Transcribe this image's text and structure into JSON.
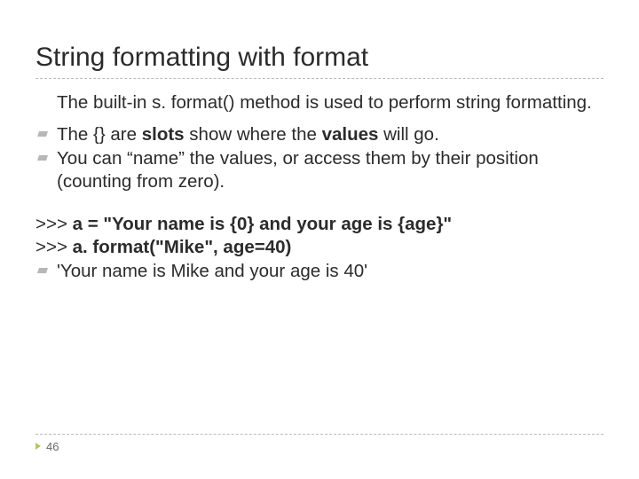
{
  "title": "String formatting with format",
  "intro": "The built-in s. format() method is used to perform string formatting.",
  "bullet1_pre": "The {} are ",
  "bullet1_mid": "slots",
  "bullet1_post1": " show where the ",
  "bullet1_mid2": "values",
  "bullet1_post2": " will go.",
  "bullet2": "You can “name” the values, or access them by their position (counting from zero).",
  "code": {
    "prompt": ">>> ",
    "line1": "a = \"Your name is {0} and your age is {age}\"",
    "line2": "a. format(\"Mike\", age=40)"
  },
  "output": "'Your name is Mike and your age is 40'",
  "page": "46"
}
